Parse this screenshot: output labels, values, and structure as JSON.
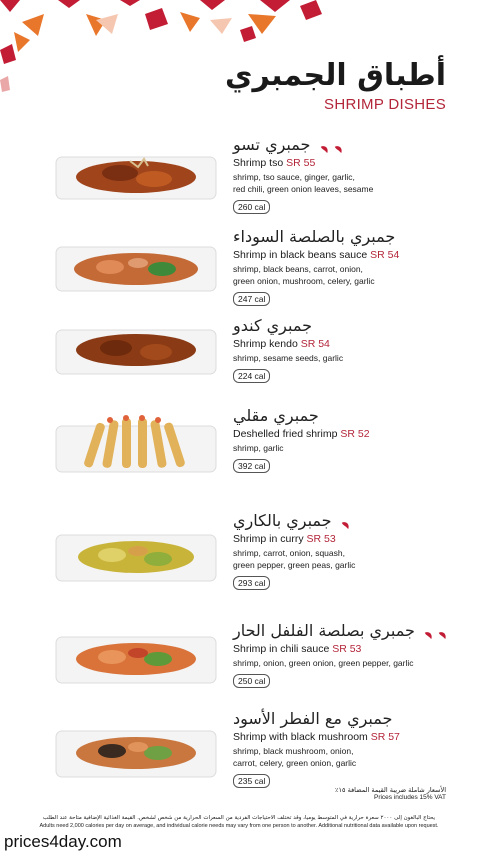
{
  "header": {
    "title_ar": "أطباق الجمبري",
    "title_en": "SHRIMP DISHES"
  },
  "colors": {
    "accent": "#b3263a",
    "pattern_orange": "#e9772b",
    "pattern_red": "#c21d35"
  },
  "items": [
    {
      "name_ar": "جمبري تسو",
      "name_en": "Shrimp tso",
      "price": "SR 55",
      "chili": 2,
      "desc": [
        "shrimp, tso sauce, ginger, garlic,",
        "red chili, green onion leaves, sesame"
      ],
      "cal": "260 cal"
    },
    {
      "name_ar": "جمبري بالصلصة السوداء",
      "name_en": "Shrimp in black beans sauce",
      "price": "SR 54",
      "chili": 0,
      "desc": [
        "shrimp, black beans, carrot, onion,",
        "green onion, mushroom, celery, garlic"
      ],
      "cal": "247 cal"
    },
    {
      "name_ar": "جمبري كندو",
      "name_en": "Shrimp kendo",
      "price": "SR 54",
      "chili": 0,
      "desc": [
        "shrimp, sesame seeds, garlic"
      ],
      "cal": "224 cal"
    },
    {
      "name_ar": "جمبري مقلي",
      "name_en": "Deshelled fried shrimp",
      "price": "SR 52",
      "chili": 0,
      "desc": [
        "shrimp, garlic"
      ],
      "cal": "392 cal"
    },
    {
      "name_ar": "جمبري بالكاري",
      "name_en": "Shrimp in curry",
      "price": "SR 53",
      "chili": 1,
      "desc": [
        "shrimp, carrot, onion, squash,",
        "green pepper, green peas, garlic"
      ],
      "cal": "293 cal"
    },
    {
      "name_ar": "جمبري بصلصة الفلفل الحار",
      "name_en": "Shrimp in chili sauce",
      "price": "SR 53",
      "chili": 2,
      "desc": [
        "shrimp, onion, green onion, green pepper, garlic"
      ],
      "cal": "250 cal"
    },
    {
      "name_ar": "جمبري مع الفطر الأسود",
      "name_en": "Shrimp with black mushroom",
      "price": "SR 57",
      "chili": 0,
      "desc": [
        "shrimp, black mushroom, onion,",
        "carrot, celery, green onion, garlic"
      ],
      "cal": "235 cal"
    }
  ],
  "footer": {
    "vat_ar": "الأسعار شاملة ضريبة القيمة المضافة ١٥٪",
    "vat_en": "Prices includes 15% VAT",
    "fine_ar": "يحتاج البالغون إلى ٢٠٠٠ سعرة حرارية في المتوسط يومياً، وقد تختلف الاحتياجات الفردية من السعرات الحرارية من شخص لشخص. القيمة الغذائية الإضافية متاحة عند الطلب",
    "fine_en": "Adults need 2,000 calories per day on average, and individual calorie needs may vary from one person to another. Additional nutritional data available upon request.",
    "watermark": "prices4day.com"
  }
}
